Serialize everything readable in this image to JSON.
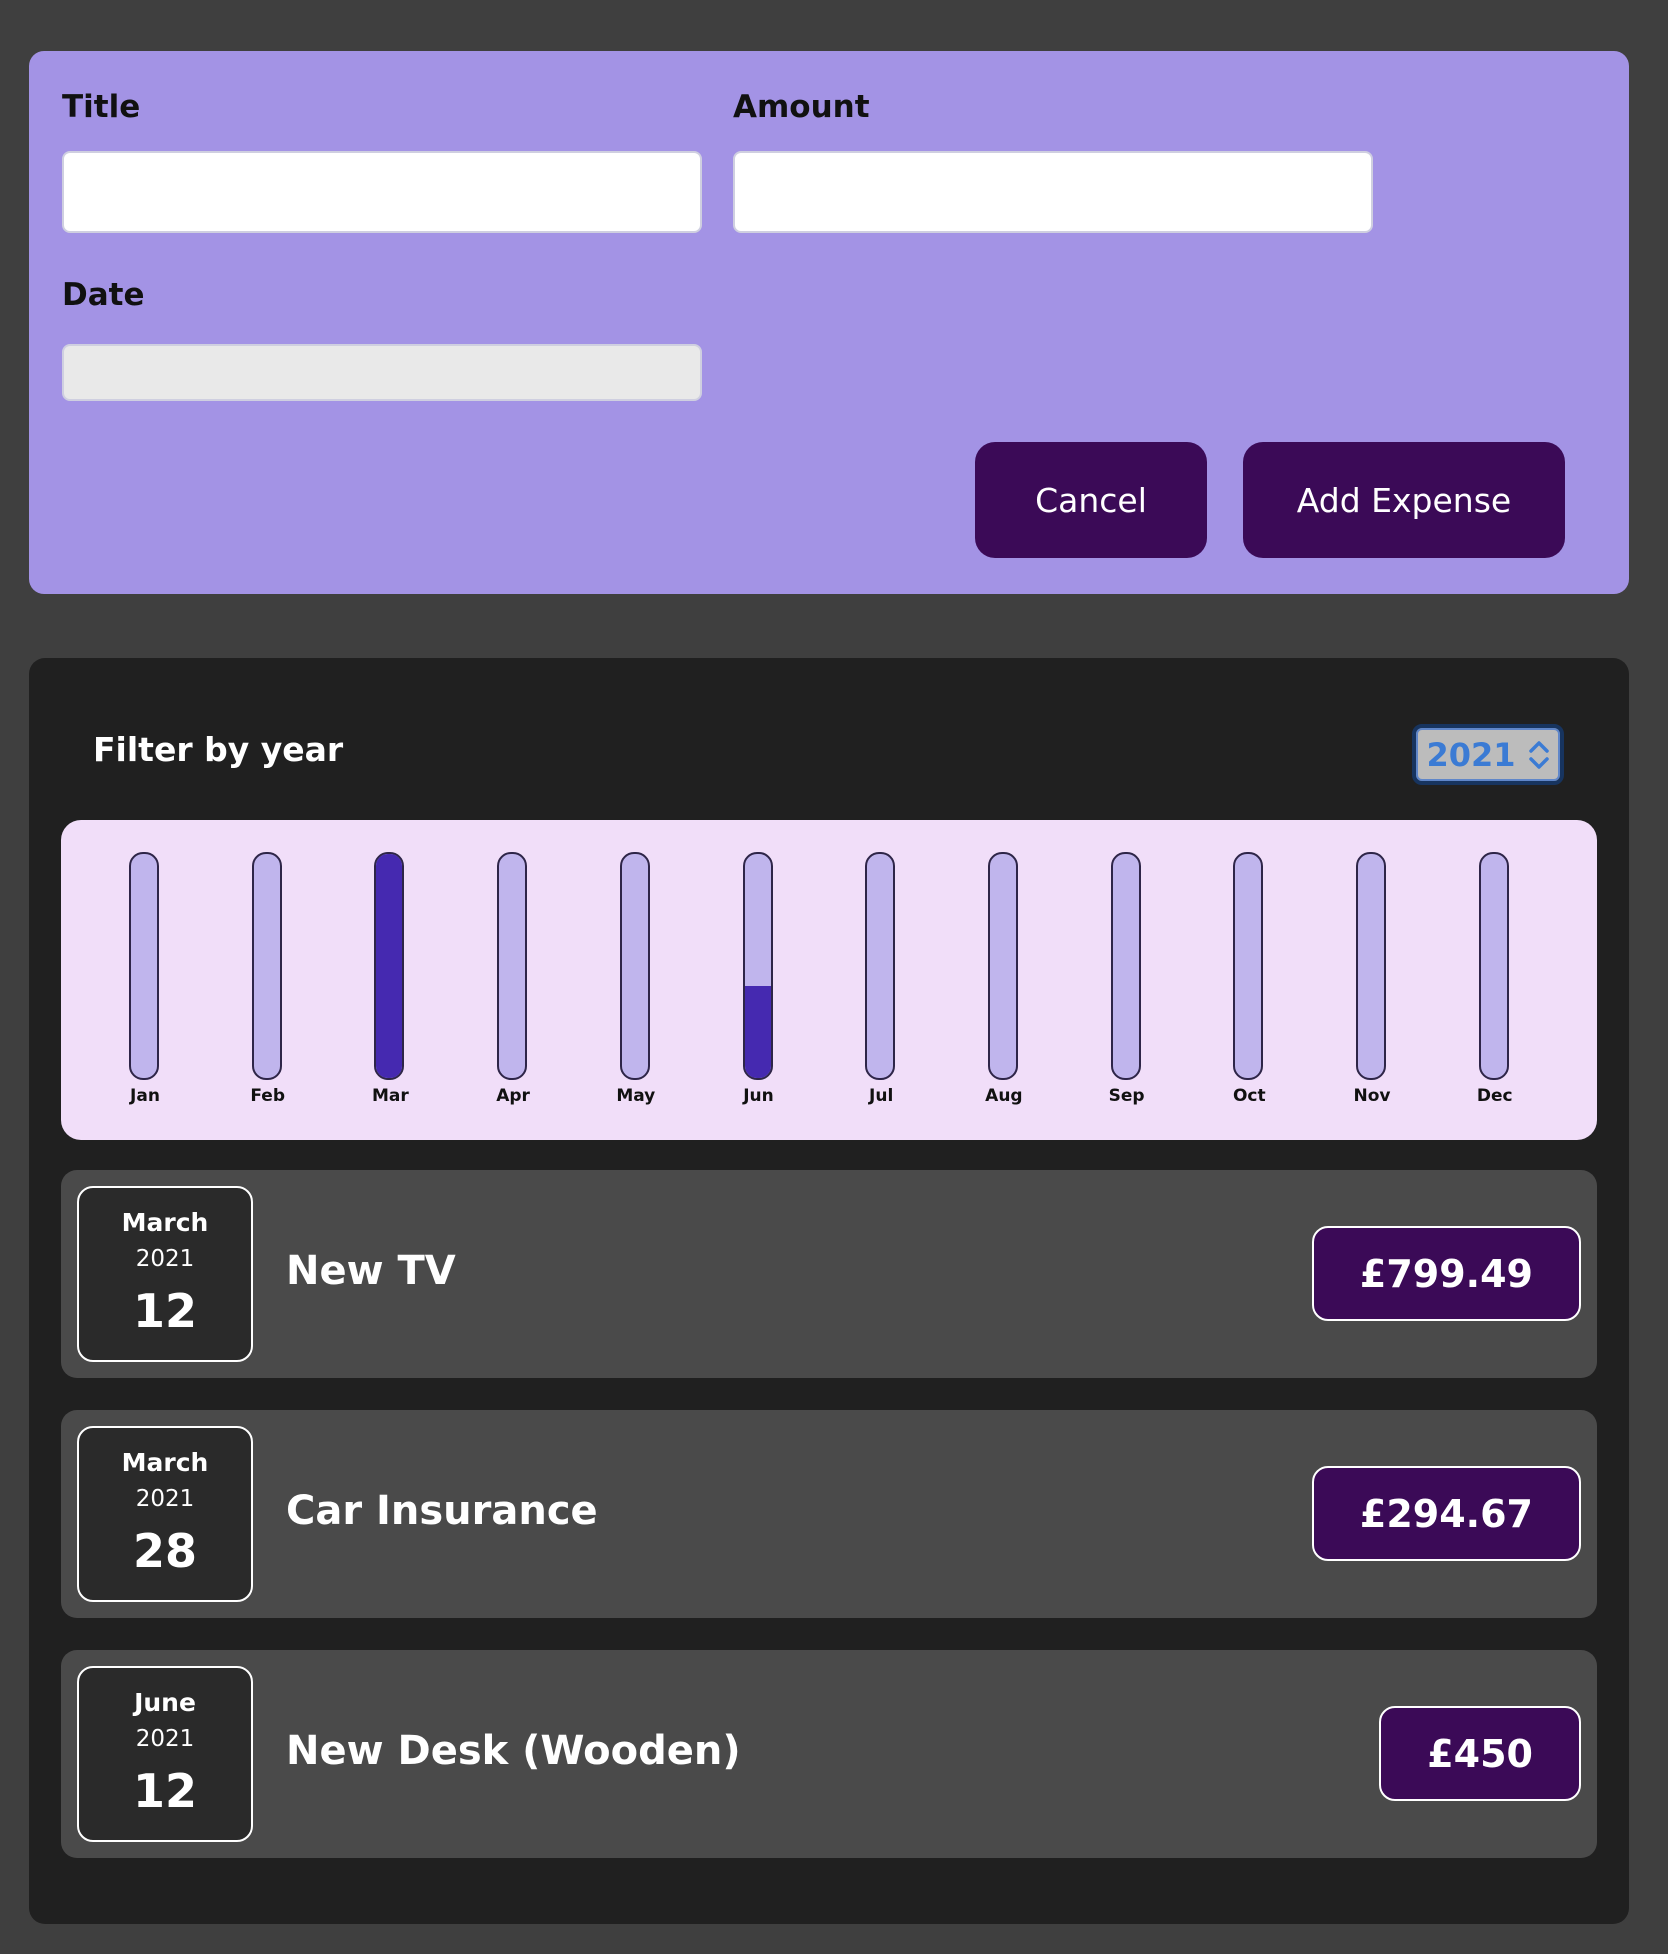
{
  "form": {
    "title_label": "Title",
    "amount_label": "Amount",
    "date_label": "Date",
    "title_value": "",
    "amount_value": "",
    "date_value": "",
    "cancel_label": "Cancel",
    "add_label": "Add Expense"
  },
  "filter": {
    "label": "Filter by year",
    "selected_year": "2021"
  },
  "chart_data": {
    "type": "bar",
    "categories": [
      "Jan",
      "Feb",
      "Mar",
      "Apr",
      "May",
      "Jun",
      "Jul",
      "Aug",
      "Sep",
      "Oct",
      "Nov",
      "Dec"
    ],
    "values": [
      0,
      0,
      1094.16,
      0,
      0,
      450,
      0,
      0,
      0,
      0,
      0,
      0
    ],
    "ylim": [
      0,
      1094.16
    ]
  },
  "expenses": [
    {
      "month": "March",
      "year": "2021",
      "day": "12",
      "title": "New TV",
      "amount": "£799.49"
    },
    {
      "month": "March",
      "year": "2021",
      "day": "28",
      "title": "Car Insurance",
      "amount": "£294.67"
    },
    {
      "month": "June",
      "year": "2021",
      "day": "12",
      "title": "New Desk (Wooden)",
      "amount": "£450"
    }
  ],
  "colors": {
    "form_bg": "#a393e5",
    "button_bg": "#3b0a57",
    "chart_bg": "#f1def9",
    "bar_track": "#c0b5ed",
    "bar_fill": "#4529b0",
    "panel_bg": "#202020",
    "item_bg": "#4a4a4a"
  }
}
